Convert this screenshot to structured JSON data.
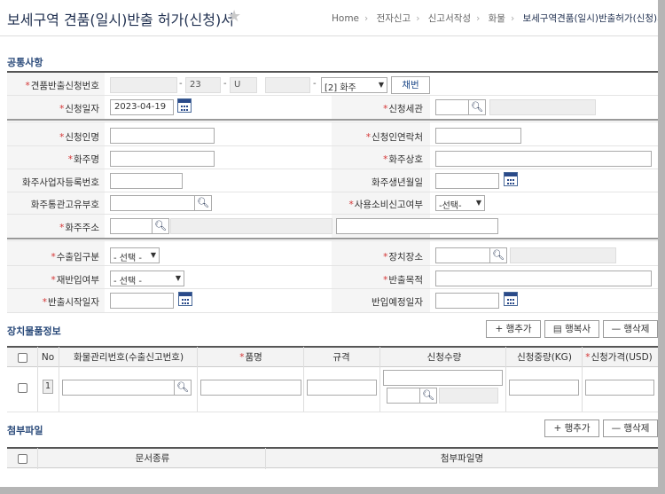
{
  "header": {
    "title": "보세구역 견품(일시)반출 허가(신청)서",
    "breadcrumb": [
      "Home",
      "전자신고",
      "신고서작성",
      "화물",
      "보세구역견품(일시)반출허가(신청)서"
    ]
  },
  "sections": {
    "common": "공통사항",
    "goods": "장치물품정보",
    "attach": "첨부파일"
  },
  "form": {
    "app_no_label": "견품반출신청번호",
    "app_no_part2": "23",
    "app_no_part3": "U",
    "app_no_type": "[2] 화주",
    "assign_button": "채번",
    "app_date_label": "신청일자",
    "app_date_value": "2023-04-19",
    "customs_label": "신청세관",
    "applicant_name_label": "신청인명",
    "applicant_contact_label": "신청인연락처",
    "owner_name_label": "화주명",
    "owner_company_label": "화주상호",
    "owner_bizno_label": "화주사업자등록번호",
    "owner_birth_label": "화주생년월일",
    "owner_customs_code_label": "화주통관고유부호",
    "use_consumption_label": "사용소비신고여부",
    "use_consumption_value": "-선택-",
    "owner_address_label": "화주주소",
    "import_export_label": "수출입구분",
    "import_export_value": "- 선택 -",
    "storage_label": "장치장소",
    "reimport_label": "재반입여부",
    "reimport_value": "- 선택 -",
    "purpose_label": "반출목적",
    "start_date_label": "반출시작일자",
    "return_date_label": "반입예정일자"
  },
  "goods_toolbar": {
    "add_row": "+ 행추가",
    "copy_row": "행복사",
    "delete_row": "— 행삭제"
  },
  "goods_table": {
    "columns": [
      "No",
      "화물관리번호(수출신고번호)",
      "품명",
      "규격",
      "신청수량",
      "신청중량(KG)",
      "신청가격(USD)"
    ],
    "row_no": "1"
  },
  "attach_toolbar": {
    "add_row": "+ 행추가",
    "delete_row": "— 행삭제"
  },
  "attach_table": {
    "columns": [
      "문서종류",
      "첨부파일명"
    ]
  }
}
